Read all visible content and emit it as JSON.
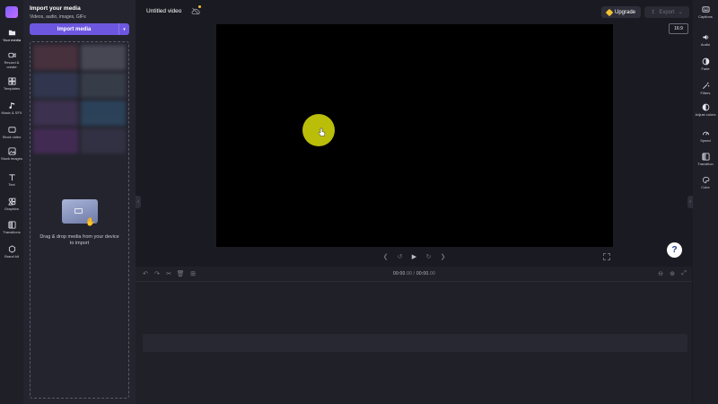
{
  "app": {
    "project_title": "Untitled video"
  },
  "left_rail": {
    "items": [
      {
        "label": "Your media",
        "icon": "folder-icon"
      },
      {
        "label": "Record & create",
        "icon": "camera-icon"
      },
      {
        "label": "Templates",
        "icon": "templates-icon"
      },
      {
        "label": "Music & SFX",
        "icon": "music-icon"
      },
      {
        "label": "Stock video",
        "icon": "video-icon"
      },
      {
        "label": "Stock images",
        "icon": "image-icon"
      },
      {
        "label": "Text",
        "icon": "text-icon"
      },
      {
        "label": "Graphics",
        "icon": "graphics-icon"
      },
      {
        "label": "Transitions",
        "icon": "transitions-icon"
      },
      {
        "label": "Brand kit",
        "icon": "brand-kit-icon"
      }
    ]
  },
  "media_panel": {
    "title": "Import your media",
    "subtitle": "Videos, audio, images, GIFs",
    "import_button": "Import media",
    "dropzone_text": "Drag & drop media from your device to import"
  },
  "topbar": {
    "upgrade_label": "Upgrade",
    "export_label": "Export"
  },
  "preview": {
    "aspect_ratio": "16:9"
  },
  "timeline": {
    "current_time": "00:00",
    "current_frac": ".00",
    "total_time": "00:00",
    "total_frac": ".00",
    "separator": "/"
  },
  "right_rail": {
    "items": [
      {
        "label": "Captions",
        "icon": "captions-icon"
      },
      {
        "label": "Audio",
        "icon": "audio-icon"
      },
      {
        "label": "Fade",
        "icon": "fade-icon"
      },
      {
        "label": "Filters",
        "icon": "filters-icon"
      },
      {
        "label": "Adjust colors",
        "icon": "adjust-colors-icon"
      },
      {
        "label": "Speed",
        "icon": "speed-icon"
      },
      {
        "label": "Transition",
        "icon": "transition-icon"
      },
      {
        "label": "Color",
        "icon": "color-icon"
      }
    ]
  },
  "help": {
    "label": "?"
  },
  "colors": {
    "accent": "#6e57e0",
    "highlight": "#c4c80a",
    "premium": "#f2c230"
  }
}
